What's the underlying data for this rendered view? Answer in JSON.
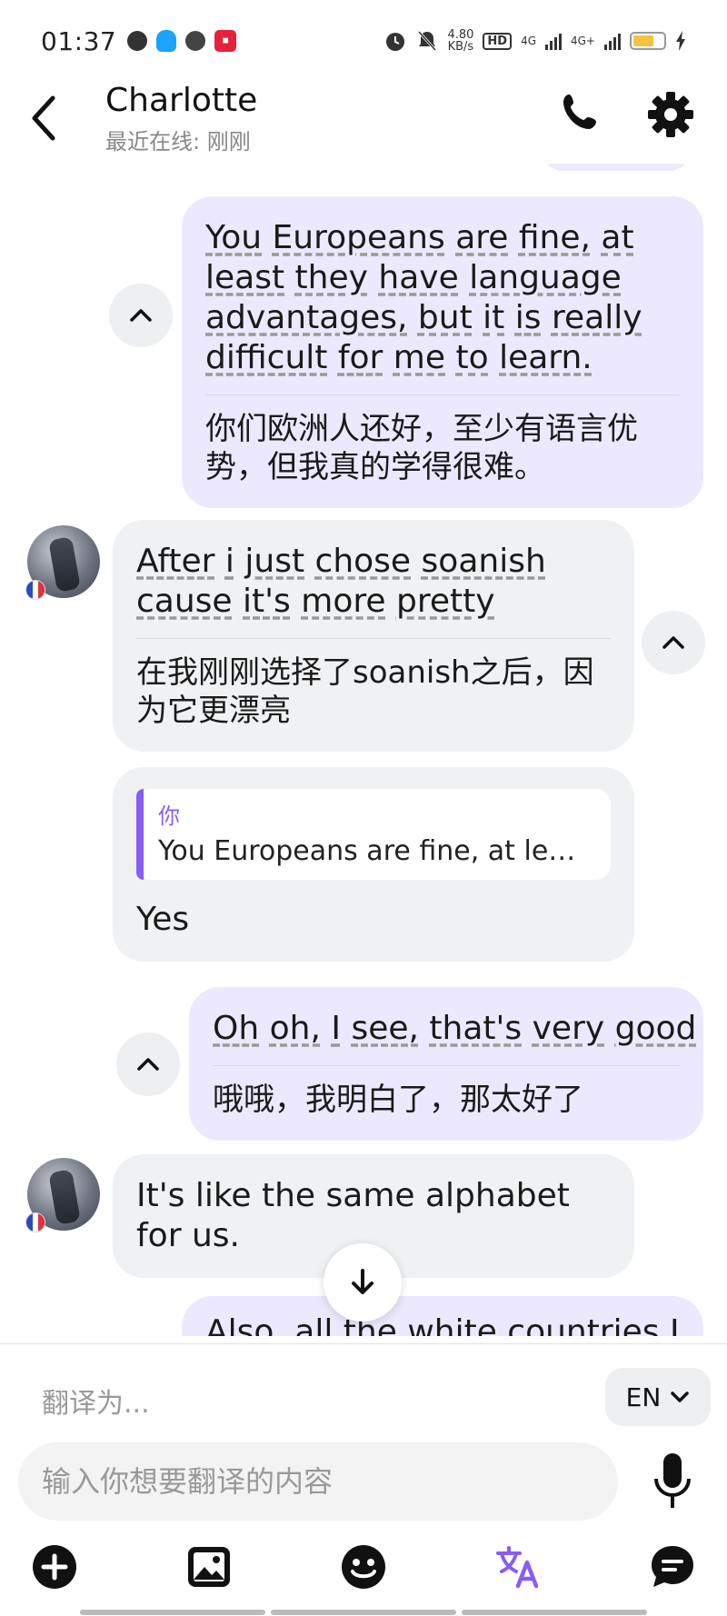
{
  "status_bar": {
    "time": "01:37",
    "speed_value": "4.80",
    "speed_unit": "KB/s",
    "hd": "HD",
    "net1": "4G",
    "net2": "4G+"
  },
  "header": {
    "name": "Charlotte",
    "last_seen": "最近在线: 刚刚"
  },
  "messages": [
    {
      "from": "me",
      "original": [
        "You",
        "Europeans",
        "are",
        "fine,",
        "at",
        "least",
        "they",
        "have",
        "language",
        "advantages,",
        "but",
        "it",
        "is",
        "really",
        "difficult",
        "for",
        "me",
        "to",
        "learn."
      ],
      "translation": "你们欧洲人还好，至少有语言优势，但我真的学得很难。"
    },
    {
      "from": "Charlotte",
      "original": [
        "After",
        "i",
        "just",
        "chose",
        "soanish",
        "cause",
        "it's",
        "more",
        "pretty"
      ],
      "translation": "在我刚刚选择了soanish之后，因为它更漂亮"
    },
    {
      "from": "Charlotte",
      "quote_author": "你",
      "quote_text": "You Europeans are fine, at le…",
      "text": "Yes"
    },
    {
      "from": "me",
      "original": [
        "Oh",
        "oh,",
        "I",
        "see,",
        "that's",
        "very",
        "good"
      ],
      "translation": "哦哦，我明白了，那太好了"
    },
    {
      "from": "Charlotte",
      "text": "It's like the same alphabet for us."
    },
    {
      "from": "me",
      "partial_text": "Also, all the white countries I"
    }
  ],
  "composer": {
    "translate_to_label": "翻译为...",
    "language": "EN",
    "input_placeholder": "输入你想要翻译的内容"
  },
  "toolbar_icons": [
    "add-icon",
    "image-icon",
    "emoji-icon",
    "translate-icon",
    "chat-icon"
  ],
  "colors": {
    "accent": "#8a5cf6",
    "my_bubble": "#ece9fe",
    "their_bubble": "#f0f1f2"
  }
}
